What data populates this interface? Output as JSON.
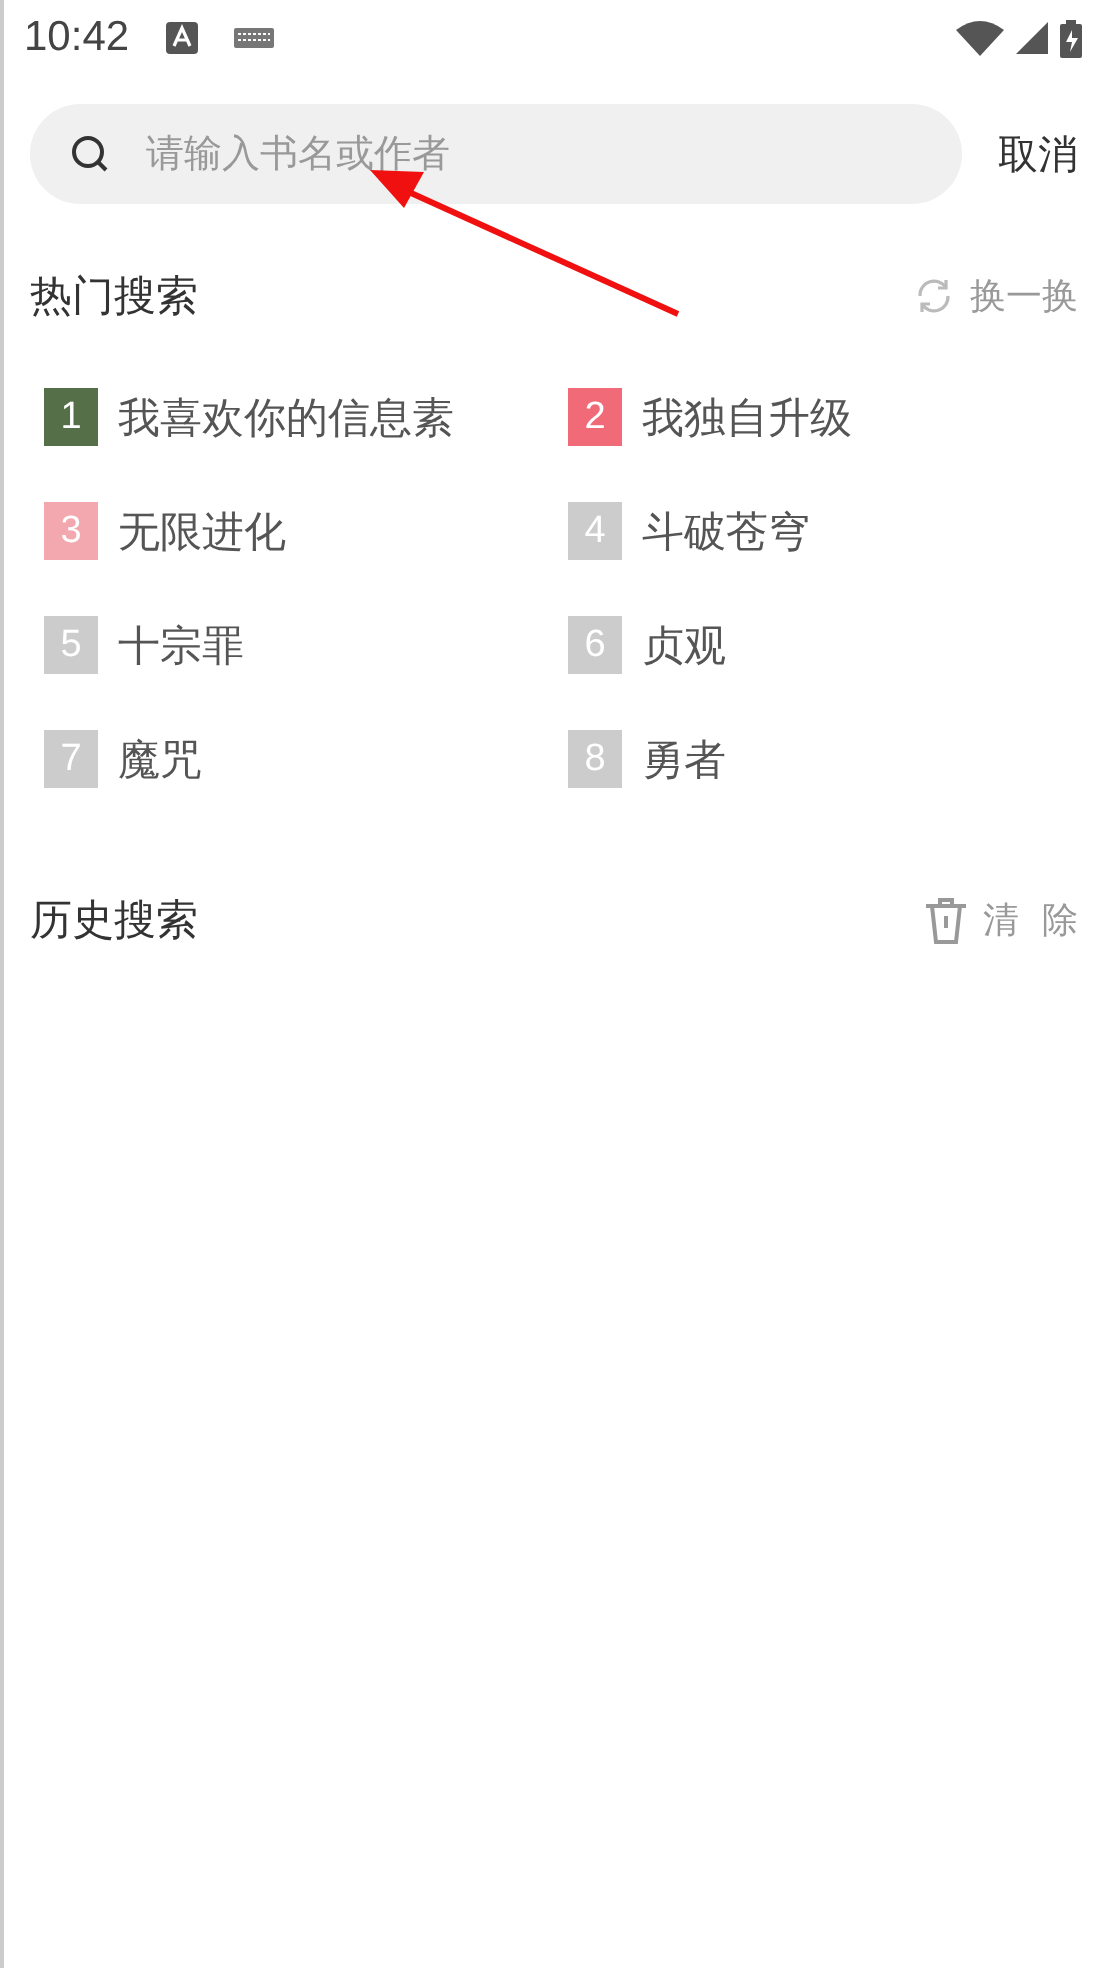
{
  "status_bar": {
    "time": "10:42"
  },
  "search": {
    "placeholder": "请输入书名或作者",
    "cancel": "取消"
  },
  "hot": {
    "title": "热门搜索",
    "refresh": "换一换",
    "items": [
      {
        "rank": "1",
        "title": "我喜欢你的信息素",
        "color": "#557048"
      },
      {
        "rank": "2",
        "title": "我独自升级",
        "color": "#f06a78"
      },
      {
        "rank": "3",
        "title": "无限进化",
        "color": "#f2a8ae"
      },
      {
        "rank": "4",
        "title": "斗破苍穹",
        "color": "#cccccc"
      },
      {
        "rank": "5",
        "title": "十宗罪",
        "color": "#cccccc"
      },
      {
        "rank": "6",
        "title": "贞观",
        "color": "#cccccc"
      },
      {
        "rank": "7",
        "title": "魔咒",
        "color": "#cccccc"
      },
      {
        "rank": "8",
        "title": "勇者",
        "color": "#cccccc"
      }
    ]
  },
  "history": {
    "title": "历史搜索",
    "clear": "清  除"
  }
}
